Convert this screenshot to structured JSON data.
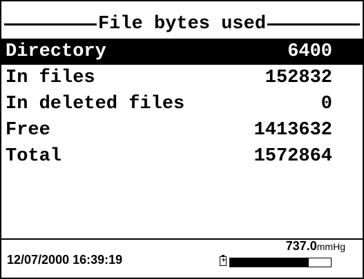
{
  "title": "File bytes used",
  "rows": [
    {
      "label": "Directory",
      "value": "6400",
      "selected": true
    },
    {
      "label": "In files",
      "value": "152832",
      "selected": false
    },
    {
      "label": "In deleted files",
      "value": "0",
      "selected": false
    },
    {
      "label": "Free",
      "value": "1413632",
      "selected": false
    },
    {
      "label": "Total",
      "value": "1572864",
      "selected": false
    }
  ],
  "status": {
    "datetime": "12/07/2000 16:39:19",
    "pressure_value": "737.0",
    "pressure_unit": "mmHg",
    "battery_level": 0.78,
    "battery_icon": "battery-icon"
  },
  "colors": {
    "foreground": "#000000",
    "background": "#ffffff"
  }
}
